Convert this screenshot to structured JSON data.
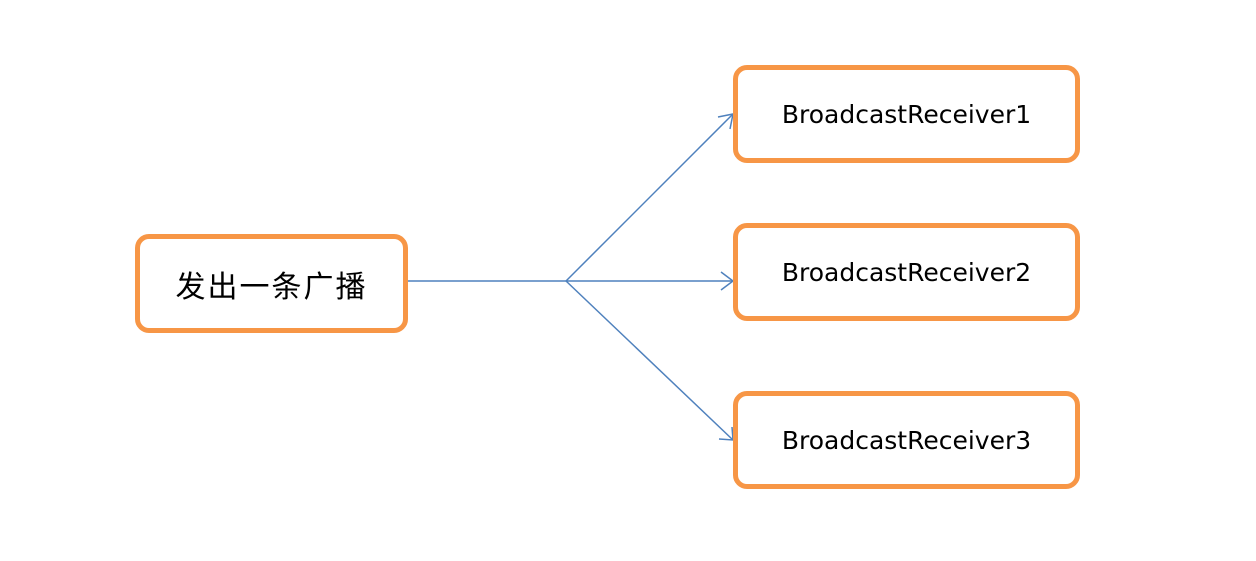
{
  "diagram": {
    "source": {
      "label": "发出一条广播"
    },
    "receivers": [
      {
        "label": "BroadcastReceiver1"
      },
      {
        "label": "BroadcastReceiver2"
      },
      {
        "label": "BroadcastReceiver3"
      }
    ],
    "colors": {
      "box_border": "#f79646",
      "connector": "#4f81bd",
      "background": "#ffffff",
      "text": "#000000"
    }
  }
}
